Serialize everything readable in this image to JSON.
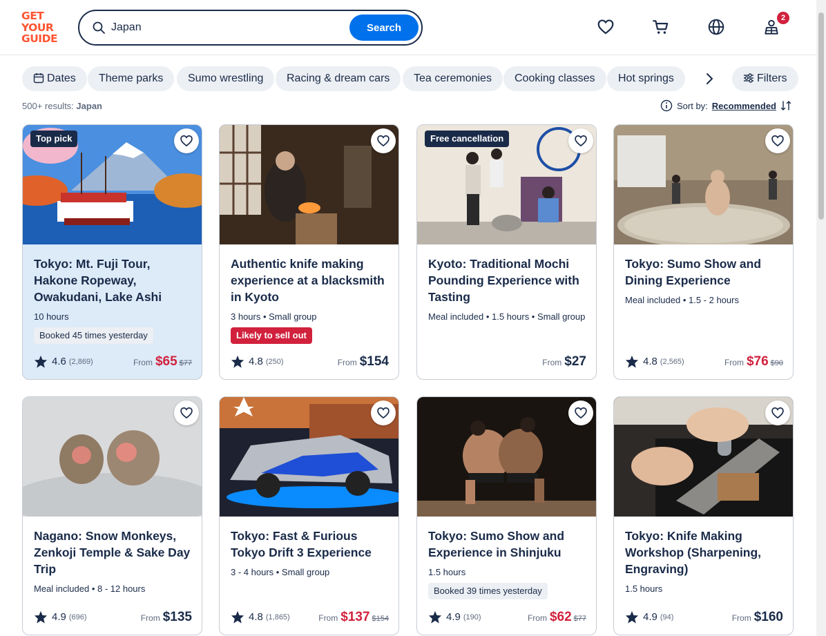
{
  "header": {
    "logo_lines": [
      "GET",
      "YOUR",
      "GUIDE"
    ],
    "search_value": "Japan",
    "search_button": "Search",
    "cart_badge": "2",
    "icons": [
      "heart-icon",
      "cart-icon",
      "globe-icon",
      "account-icon"
    ]
  },
  "filters": {
    "dates": "Dates",
    "chips": [
      "Theme parks",
      "Sumo wrestling",
      "Racing & dream cars",
      "Tea ceremonies",
      "Cooking classes",
      "Hot springs"
    ],
    "filters_label": "Filters"
  },
  "results": {
    "count": "500+ results:",
    "query": "Japan",
    "sort_label": "Sort by:",
    "sort_value": "Recommended"
  },
  "cards": [
    {
      "tag": "Top pick",
      "title": "Tokyo: Mt. Fuji Tour, Hakone Ropeway, Owakudani, Lake Ashi",
      "meta": "10 hours",
      "pill": "Booked 45 times yesterday",
      "rating": "4.6",
      "reviews": "(2,869)",
      "from": "From",
      "price": "$65",
      "old_price": "$77"
    },
    {
      "tag": "",
      "title": "Authentic knife making experience at a blacksmith in Kyoto",
      "meta": "3 hours • Small group",
      "pill": "Likely to sell out",
      "rating": "4.8",
      "reviews": "(250)",
      "from": "From",
      "price": "$154",
      "old_price": ""
    },
    {
      "tag": "Free cancellation",
      "title": "Kyoto: Traditional Mochi Pounding Experience with Tasting",
      "meta": "Meal included • 1.5 hours • Small group",
      "pill": "",
      "rating": "",
      "reviews": "",
      "from": "From",
      "price": "$27",
      "old_price": ""
    },
    {
      "tag": "",
      "title": "Tokyo: Sumo Show and Dining Experience",
      "meta": "Meal included • 1.5 - 2 hours",
      "pill": "",
      "rating": "4.8",
      "reviews": "(2,565)",
      "from": "From",
      "price": "$76",
      "old_price": "$90"
    },
    {
      "tag": "",
      "title": "Nagano: Snow Monkeys, Zenkoji Temple & Sake Day Trip",
      "meta": "Meal included • 8 - 12 hours",
      "pill": "",
      "rating": "4.9",
      "reviews": "(696)",
      "from": "From",
      "price": "$135",
      "old_price": ""
    },
    {
      "tag": "",
      "title": "Tokyo: Fast & Furious Tokyo Drift 3 Experience",
      "meta": "3 - 4 hours • Small group",
      "pill": "",
      "rating": "4.8",
      "reviews": "(1,865)",
      "from": "From",
      "price": "$137",
      "old_price": "$154"
    },
    {
      "tag": "",
      "title": "Tokyo: Sumo Show and Experience in Shinjuku",
      "meta": "1.5 hours",
      "pill": "Booked 39 times yesterday",
      "rating": "4.9",
      "reviews": "(190)",
      "from": "From",
      "price": "$62",
      "old_price": "$77"
    },
    {
      "tag": "",
      "title": "Tokyo: Knife Making Workshop (Sharpening, Engraving)",
      "meta": "1.5 hours",
      "pill": "",
      "rating": "4.9",
      "reviews": "(94)",
      "from": "From",
      "price": "$160",
      "old_price": ""
    }
  ],
  "colors": {
    "brand": "#ff5533",
    "primary": "#0071eb",
    "navy": "#1a2b49",
    "sale": "#d1213d"
  }
}
